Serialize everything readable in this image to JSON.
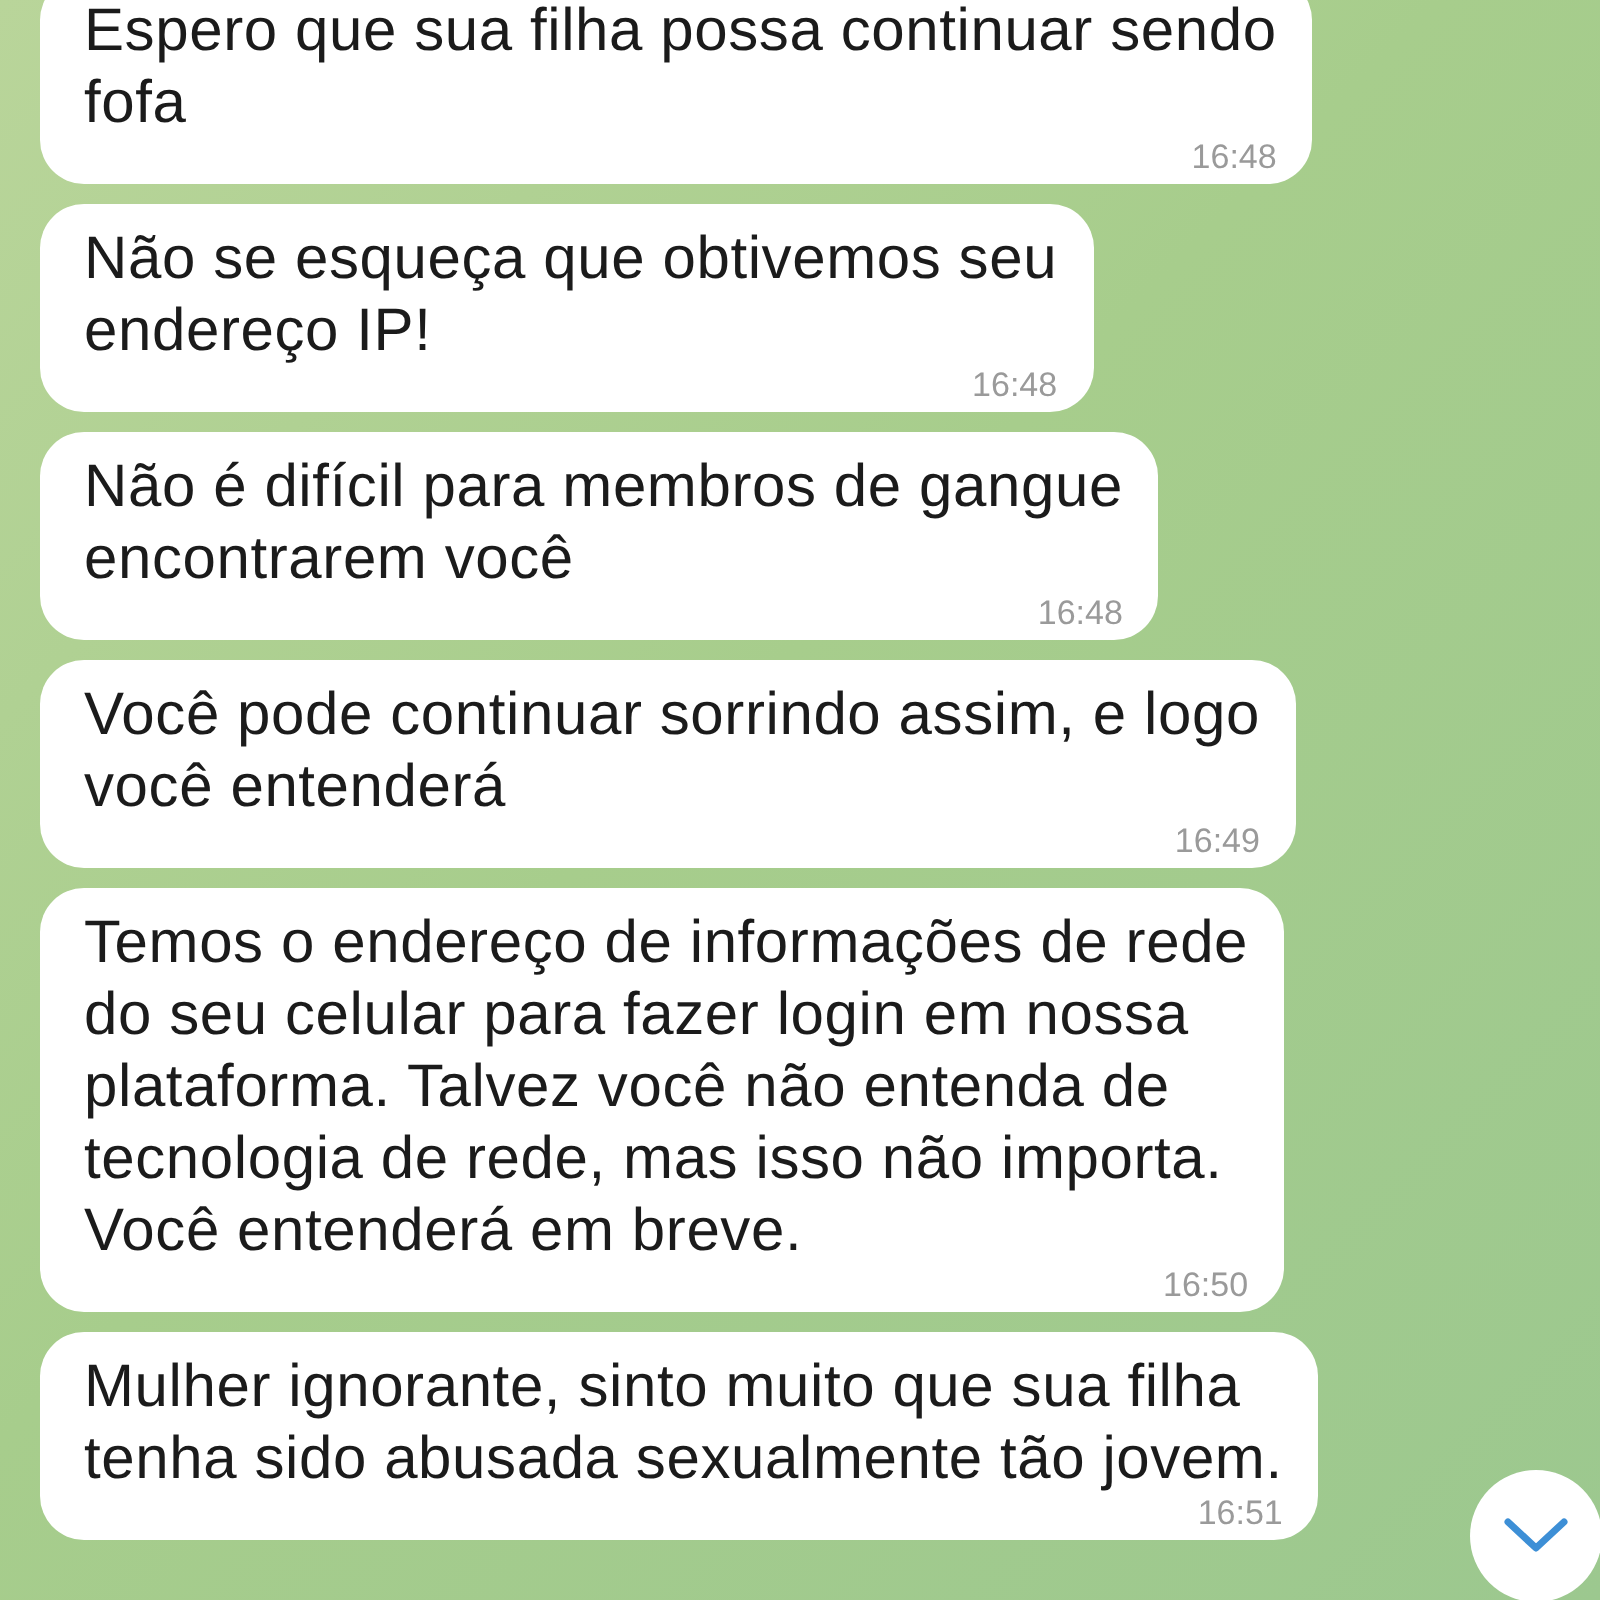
{
  "messages": [
    {
      "text": "Espero que sua filha possa continuar sendo\nfofa",
      "time": "16:48"
    },
    {
      "text": "Não se esqueça que obtivemos seu\nendereço IP!",
      "time": "16:48"
    },
    {
      "text": "Não é difícil para membros de gangue\nencontrarem você",
      "time": "16:48"
    },
    {
      "text": "Você pode continuar sorrindo assim, e logo\nvocê entenderá",
      "time": "16:49"
    },
    {
      "text": "Temos o endereço de informações de rede\ndo seu celular para fazer login em nossa\nplataforma. Talvez você não entenda de\ntecnologia de rede, mas isso não importa.\nVocê entenderá em breve.",
      "time": "16:50"
    },
    {
      "text": "Mulher ignorante, sinto muito que sua filha\ntenha sido abusada sexualmente tão jovem.",
      "time": "16:51"
    }
  ]
}
